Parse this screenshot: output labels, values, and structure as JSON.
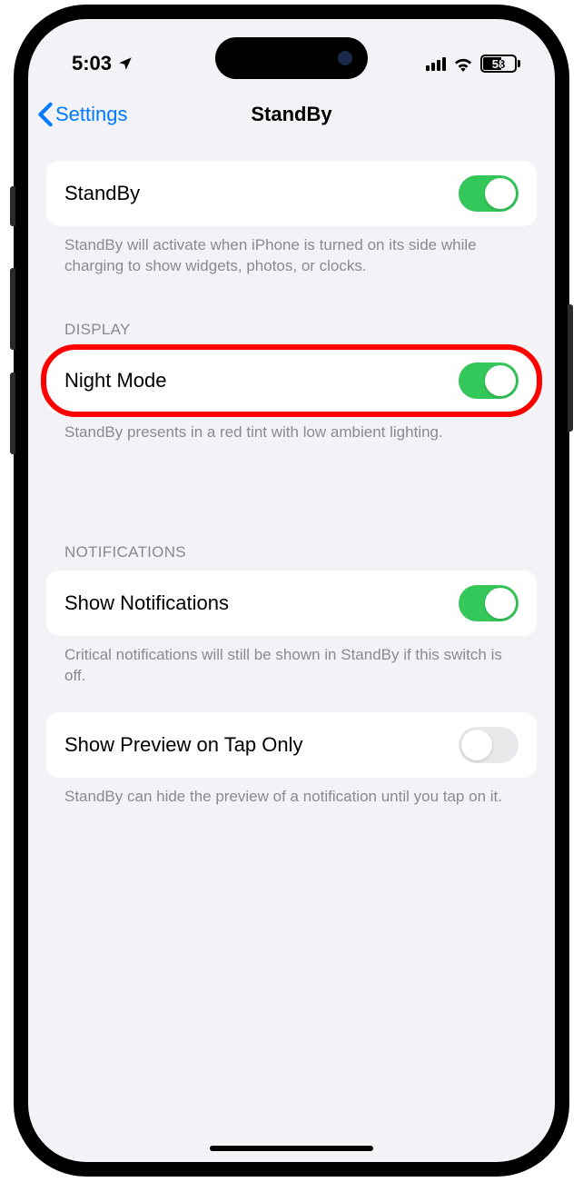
{
  "status": {
    "time": "5:03",
    "battery": "58"
  },
  "nav": {
    "back_label": "Settings",
    "title": "StandBy"
  },
  "standby": {
    "label": "StandBy",
    "footer": "StandBy will activate when iPhone is turned on its side while charging to show widgets, photos, or clocks."
  },
  "display": {
    "header": "DISPLAY",
    "night_mode_label": "Night Mode",
    "footer": "StandBy presents in a red tint with low ambient lighting."
  },
  "notifications": {
    "header": "NOTIFICATIONS",
    "show_label": "Show Notifications",
    "show_footer": "Critical notifications will still be shown in StandBy if this switch is off.",
    "preview_label": "Show Preview on Tap Only",
    "preview_footer": "StandBy can hide the preview of a notification until you tap on it."
  }
}
